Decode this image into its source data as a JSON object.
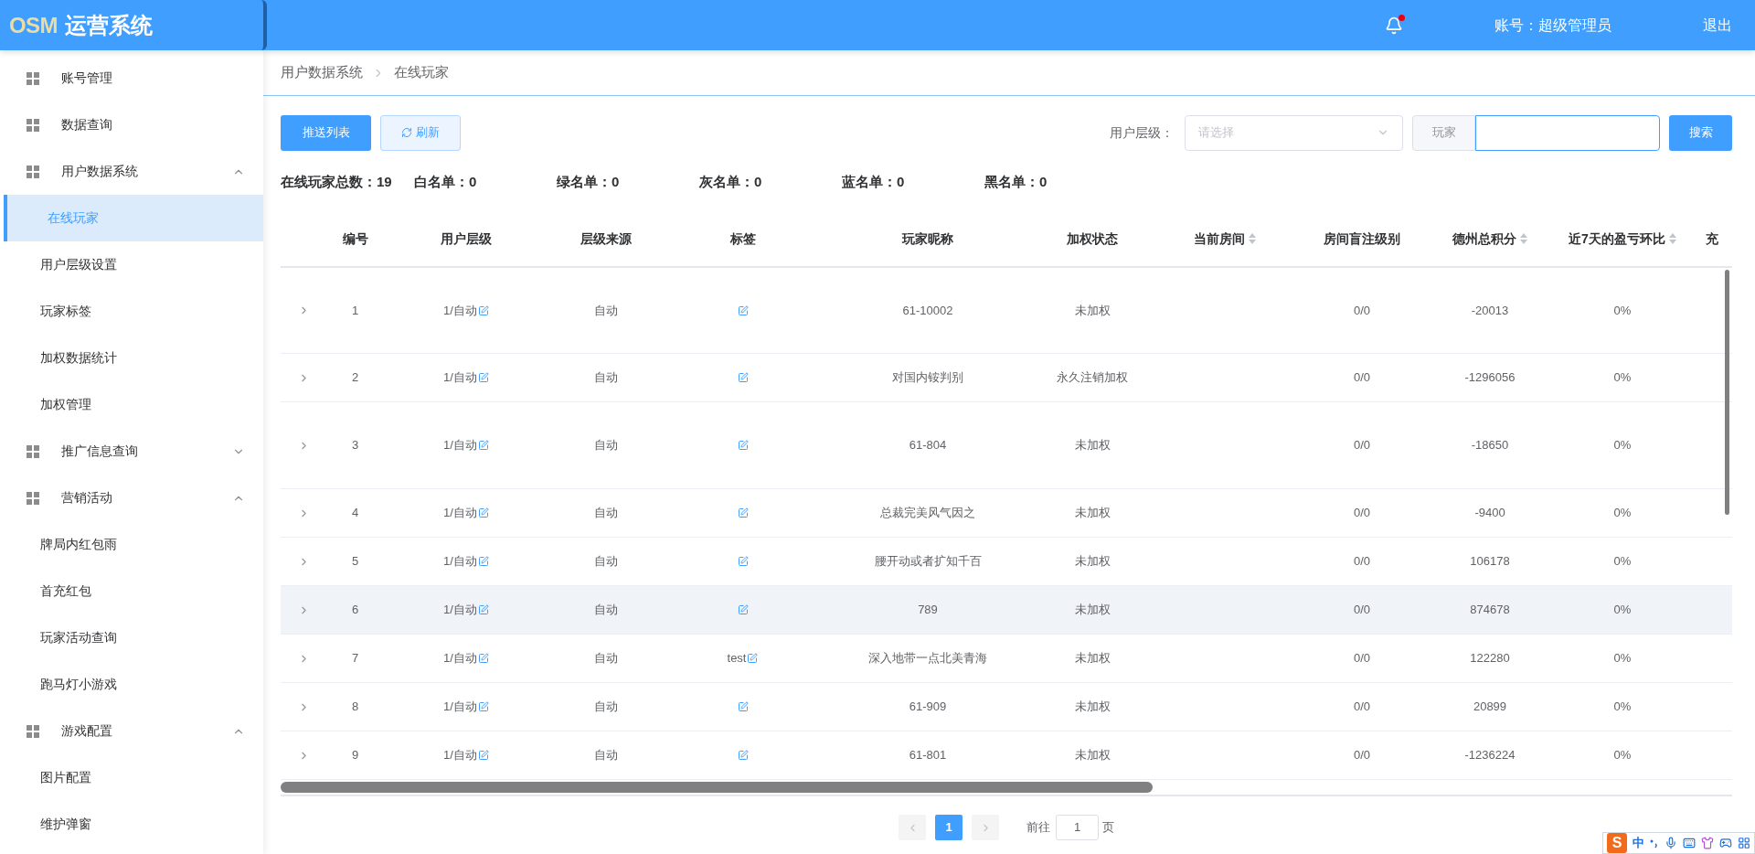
{
  "header": {
    "logo": {
      "mark": "OSM",
      "title": "运营系统"
    },
    "notification": {
      "unread": true
    },
    "account": "账号：超级管理员",
    "logout": "退出"
  },
  "sidebar": {
    "items": [
      {
        "label": "账号管理"
      },
      {
        "label": "数据查询"
      },
      {
        "label": "用户数据系统",
        "expanded": true,
        "children": [
          {
            "label": "在线玩家",
            "selected": true
          },
          {
            "label": "用户层级设置",
            "selected": false
          },
          {
            "label": "玩家标签",
            "selected": false
          },
          {
            "label": "加权数据统计",
            "selected": false
          },
          {
            "label": "加权管理",
            "selected": false
          }
        ]
      },
      {
        "label": "推广信息查询",
        "expanded": false
      },
      {
        "label": "营销活动",
        "expanded": true,
        "children": [
          {
            "label": "牌局内红包雨",
            "selected": false
          },
          {
            "label": "首充红包",
            "selected": false
          },
          {
            "label": "玩家活动查询",
            "selected": false
          },
          {
            "label": "跑马灯小游戏",
            "selected": false
          }
        ]
      },
      {
        "label": "游戏配置",
        "expanded": true,
        "children": [
          {
            "label": "图片配置",
            "selected": false
          },
          {
            "label": "维护弹窗",
            "selected": false
          }
        ]
      }
    ]
  },
  "breadcrumb": [
    "用户数据系统",
    "在线玩家"
  ],
  "toolbar": {
    "buttons": [
      {
        "label": "推送列表",
        "kind": "primary"
      },
      {
        "label": "刷新",
        "kind": "refresh"
      }
    ],
    "level_filter": {
      "label": "用户层级：",
      "placeholder": "请选择"
    },
    "player_search": {
      "prefix": "玩家"
    },
    "search_button": "搜索"
  },
  "stats": [
    "在线玩家总数：19",
    "白名单：0",
    "绿名单：0",
    "灰名单：0",
    "蓝名单：0",
    "黑名单：0"
  ],
  "table": {
    "columns": [
      {
        "label": "编号",
        "sortable": false
      },
      {
        "label": "用户层级",
        "sortable": false
      },
      {
        "label": "层级来源",
        "sortable": false
      },
      {
        "label": "标签",
        "sortable": false
      },
      {
        "label": "玩家昵称",
        "sortable": false
      },
      {
        "label": "加权状态",
        "sortable": false
      },
      {
        "label": "当前房间",
        "sortable": true
      },
      {
        "label": "房间盲注级别",
        "sortable": false
      },
      {
        "label": "德州总积分",
        "sortable": true
      },
      {
        "label": "近7天的盈亏环比",
        "sortable": true
      },
      {
        "label": "充",
        "sortable": false
      }
    ],
    "rows": [
      {
        "id": "1",
        "level": "1/自动",
        "source": "自动",
        "nickname": "61-10002",
        "status": "未加权",
        "blind": "0/0",
        "score": "-20013",
        "ratio": "0%",
        "hovered": false
      },
      {
        "id": "2",
        "level": "1/自动",
        "source": "自动",
        "nickname": "对国内铵判别",
        "status": "永久注销加权",
        "blind": "0/0",
        "score": "-1296056",
        "ratio": "0%",
        "hovered": false
      },
      {
        "id": "3",
        "level": "1/自动",
        "source": "自动",
        "nickname": "61-804",
        "status": "未加权",
        "blind": "0/0",
        "score": "-18650",
        "ratio": "0%",
        "hovered": false
      },
      {
        "id": "4",
        "level": "1/自动",
        "source": "自动",
        "nickname": "总裁完美风气因之",
        "status": "未加权",
        "blind": "0/0",
        "score": "-9400",
        "ratio": "0%",
        "hovered": false
      },
      {
        "id": "5",
        "level": "1/自动",
        "source": "自动",
        "nickname": "腰开动或者扩知千百",
        "status": "未加权",
        "blind": "0/0",
        "score": "106178",
        "ratio": "0%",
        "hovered": false
      },
      {
        "id": "6",
        "level": "1/自动",
        "source": "自动",
        "nickname": "789",
        "status": "未加权",
        "blind": "0/0",
        "score": "874678",
        "ratio": "0%",
        "hovered": true
      },
      {
        "id": "7",
        "level": "1/自动",
        "source": "自动",
        "tag": "test",
        "nickname": "深入地带一点北美青海",
        "status": "未加权",
        "blind": "0/0",
        "score": "122280",
        "ratio": "0%",
        "hovered": false
      },
      {
        "id": "8",
        "level": "1/自动",
        "source": "自动",
        "nickname": "61-909",
        "status": "未加权",
        "blind": "0/0",
        "score": "20899",
        "ratio": "0%",
        "hovered": false
      },
      {
        "id": "9",
        "level": "1/自动",
        "source": "自动",
        "nickname": "61-801",
        "status": "未加权",
        "blind": "0/0",
        "score": "-1236224",
        "ratio": "0%",
        "hovered": false
      }
    ]
  },
  "pagination": {
    "prev_disabled": true,
    "pages": [
      {
        "label": "1",
        "selected": true
      }
    ],
    "next_disabled": true,
    "goto_label": "前往",
    "goto_value": "1",
    "goto_suffix": "页"
  },
  "ime_bar": {
    "logo": "S",
    "mode": "中"
  }
}
